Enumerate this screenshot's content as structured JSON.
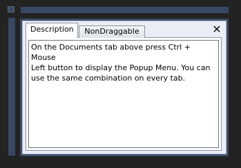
{
  "window": {
    "tabs": [
      {
        "label": "Description",
        "active": true
      },
      {
        "label": "NonDraggable",
        "active": false
      }
    ],
    "close_glyph": "✕",
    "description_text": "On the Documents tab above press Ctrl + Mouse\nLeft button to display the Popup Menu. You can\nuse the same combination on every tab."
  },
  "colors": {
    "background": "#232323",
    "frame_blue": "#384863",
    "window_fill": "#e9edf6"
  }
}
